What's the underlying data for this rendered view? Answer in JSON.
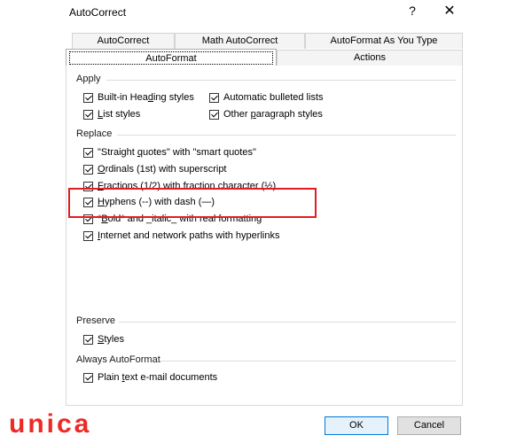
{
  "window": {
    "title": "AutoCorrect",
    "help_glyph": "?",
    "close_glyph": "✕"
  },
  "tabs_back": [
    {
      "label": "AutoCorrect"
    },
    {
      "label": "Math AutoCorrect"
    },
    {
      "label": "AutoFormat As You Type"
    }
  ],
  "tabs_front": [
    {
      "label": "AutoFormat",
      "active": true
    },
    {
      "label": "Actions",
      "active": false
    }
  ],
  "groups": {
    "apply": "Apply",
    "replace": "Replace",
    "preserve": "Preserve",
    "always": "Always AutoFormat"
  },
  "options": {
    "heading_styles": {
      "pre": "Built-in Hea",
      "key": "d",
      "post": "ing styles",
      "checked": true
    },
    "bulleted_lists": {
      "pre": "Automatic bulleted lists",
      "key": "",
      "post": "",
      "checked": true
    },
    "list_styles": {
      "pre": "",
      "key": "L",
      "post": "ist styles",
      "checked": true
    },
    "paragraph_styles": {
      "pre": "Other ",
      "key": "p",
      "post": "aragraph styles",
      "checked": true
    },
    "smart_quotes": {
      "pre": "\"Straight ",
      "key": "q",
      "post": "uotes\" with \"smart quotes\"",
      "checked": true
    },
    "ordinals": {
      "pre": "",
      "key": "O",
      "post": "rdinals (1st) with superscript",
      "checked": true
    },
    "fractions": {
      "pre": "",
      "key": "F",
      "post": "ractions (1/2) with fraction character (½)",
      "checked": true
    },
    "hyphens": {
      "pre": "",
      "key": "H",
      "post": "yphens (--) with dash (—)",
      "checked": true
    },
    "bold_italic": {
      "pre": "*",
      "key": "B",
      "post": "old* and _italic_ with real formatting",
      "checked": true
    },
    "internet_paths": {
      "pre": "",
      "key": "I",
      "post": "nternet and network paths with hyperlinks",
      "checked": true
    },
    "styles": {
      "pre": "",
      "key": "S",
      "post": "tyles",
      "checked": true
    },
    "plain_email": {
      "pre": "Plain ",
      "key": "t",
      "post": "ext e-mail documents",
      "checked": true
    }
  },
  "buttons": {
    "ok": "OK",
    "cancel": "Cancel"
  },
  "logo": "unica",
  "colors": {
    "highlight": "#e21c21",
    "logo": "#ee2a24",
    "default_button_border": "#0078d7"
  }
}
